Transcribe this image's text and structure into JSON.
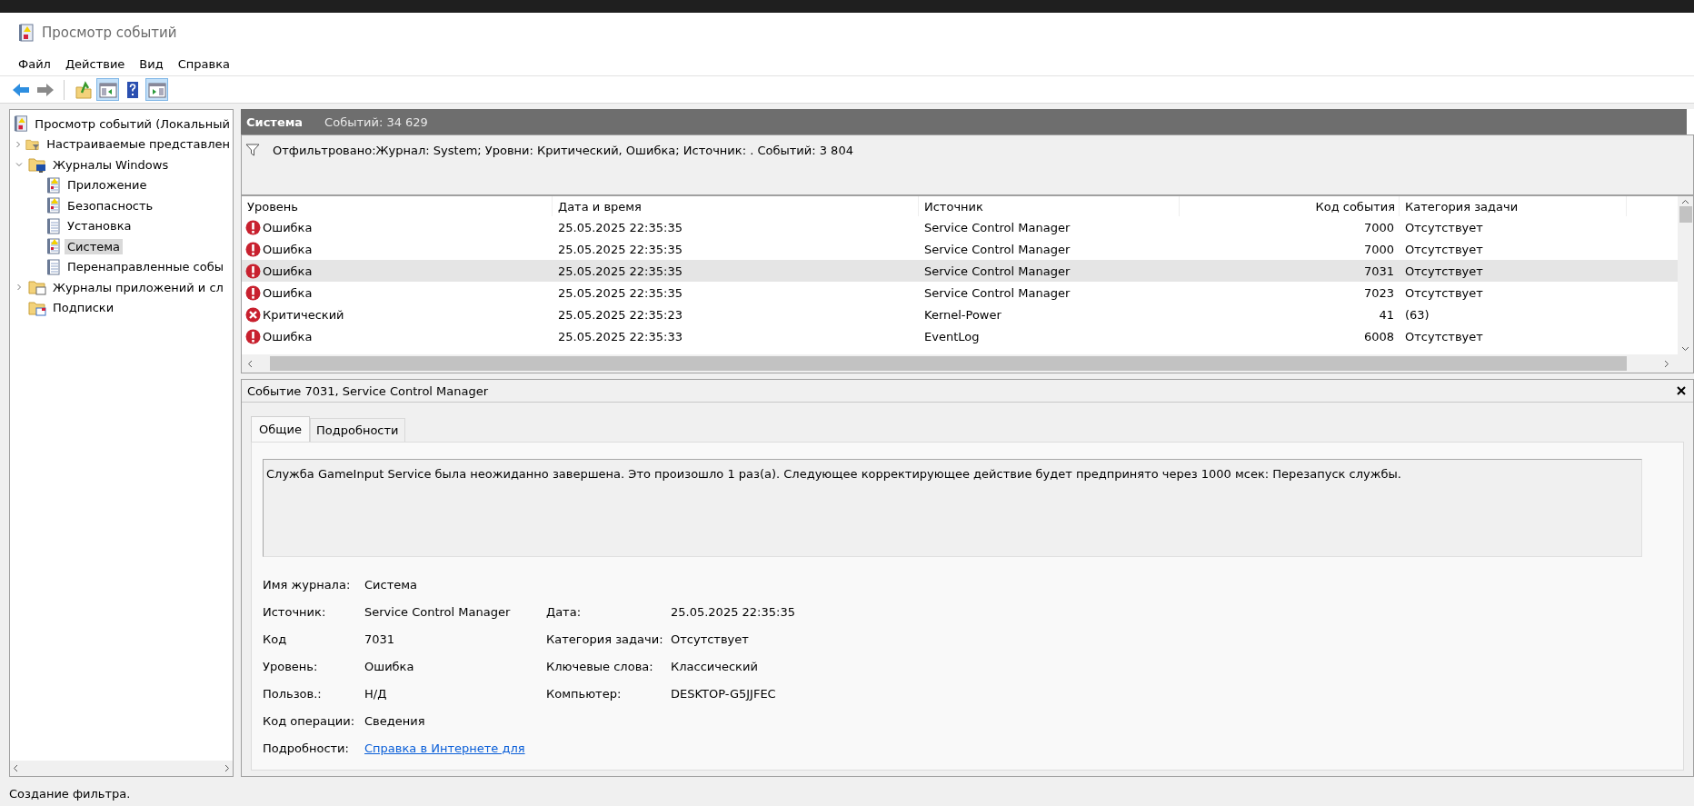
{
  "window": {
    "title": "Просмотр событий"
  },
  "menu": [
    "Файл",
    "Действие",
    "Вид",
    "Справка"
  ],
  "toolbar": [
    {
      "kind": "back",
      "pressed": false
    },
    {
      "kind": "forward",
      "pressed": false
    },
    {
      "kind": "up",
      "pressed": false
    },
    {
      "kind": "tree-pane",
      "pressed": true
    },
    {
      "kind": "help",
      "pressed": false
    },
    {
      "kind": "action-pane",
      "pressed": true
    }
  ],
  "tree": {
    "label": "Просмотр событий (Локальный",
    "kind": "root",
    "selected": false,
    "children": [
      {
        "label": "Настраиваемые представлен",
        "kind": "custom-views",
        "selected": false,
        "expanded": false
      },
      {
        "label": "Журналы Windows",
        "kind": "folder-windows",
        "selected": false,
        "expanded": true,
        "children": [
          {
            "label": "Приложение",
            "kind": "log",
            "selected": false
          },
          {
            "label": "Безопасность",
            "kind": "log",
            "selected": false
          },
          {
            "label": "Установка",
            "kind": "log-plain",
            "selected": false
          },
          {
            "label": "Система",
            "kind": "log",
            "selected": true
          },
          {
            "label": "Перенаправленные собы",
            "kind": "log-plain",
            "selected": false
          }
        ]
      },
      {
        "label": "Журналы приложений и сл",
        "kind": "folder-apps",
        "selected": false,
        "expanded": false
      },
      {
        "label": "Подписки",
        "kind": "subscriptions",
        "selected": false
      }
    ]
  },
  "header": {
    "title": "Система",
    "count": "Событий: 34 629"
  },
  "filter": {
    "text": "Отфильтровано:Журнал: System; Уровни: Критический, Ошибка; Источник: . Событий: 3 804"
  },
  "table": {
    "columns": [
      "Уровень",
      "Дата и время",
      "Источник",
      "Код события",
      "Категория задачи"
    ],
    "rows": [
      {
        "kind": "error",
        "level": "Ошибка",
        "datetime": "25.05.2025 22:35:35",
        "source": "Service Control Manager",
        "event_id": "7000",
        "category": "Отсутствует",
        "selected": false
      },
      {
        "kind": "error",
        "level": "Ошибка",
        "datetime": "25.05.2025 22:35:35",
        "source": "Service Control Manager",
        "event_id": "7000",
        "category": "Отсутствует",
        "selected": false
      },
      {
        "kind": "error",
        "level": "Ошибка",
        "datetime": "25.05.2025 22:35:35",
        "source": "Service Control Manager",
        "event_id": "7031",
        "category": "Отсутствует",
        "selected": true
      },
      {
        "kind": "error",
        "level": "Ошибка",
        "datetime": "25.05.2025 22:35:35",
        "source": "Service Control Manager",
        "event_id": "7023",
        "category": "Отсутствует",
        "selected": false
      },
      {
        "kind": "critical",
        "level": "Критический",
        "datetime": "25.05.2025 22:35:23",
        "source": "Kernel-Power",
        "event_id": "41",
        "category": "(63)",
        "selected": false
      },
      {
        "kind": "error",
        "level": "Ошибка",
        "datetime": "25.05.2025 22:35:33",
        "source": "EventLog",
        "event_id": "6008",
        "category": "Отсутствует",
        "selected": false
      }
    ]
  },
  "detail": {
    "title": "Событие 7031, Service Control Manager",
    "tabs": [
      {
        "label": "Общие",
        "selected": true
      },
      {
        "label": "Подробности",
        "selected": false
      }
    ],
    "message": "Служба GameInput Service была неожиданно завершена. Это произошло 1 раз(а). Следующее корректирующее действие будет предпринято через 1000 мсек: Перезапуск службы.",
    "fields": [
      {
        "label": "Имя журнала:",
        "value": "Система"
      },
      {
        "label": "Источник:",
        "value": "Service Control Manager",
        "label_2": "Дата:",
        "value_2": "25.05.2025 22:35:35"
      },
      {
        "label": "Код",
        "value": "7031",
        "label_2": "Категория задачи:",
        "value_2": "Отсутствует"
      },
      {
        "label": "Уровень:",
        "value": "Ошибка",
        "label_2": "Ключевые слова:",
        "value_2": "Классический"
      },
      {
        "label": "Пользов.:",
        "value": "Н/Д",
        "label_2": "Компьютер:",
        "value_2": "DESKTOP-G5JJFEC"
      },
      {
        "label": "Код операции:",
        "value": "Сведения"
      },
      {
        "label": "Подробности:",
        "value": "Справка в Интернете для",
        "kind": "link"
      }
    ]
  },
  "status_bar": "Создание фильтра."
}
